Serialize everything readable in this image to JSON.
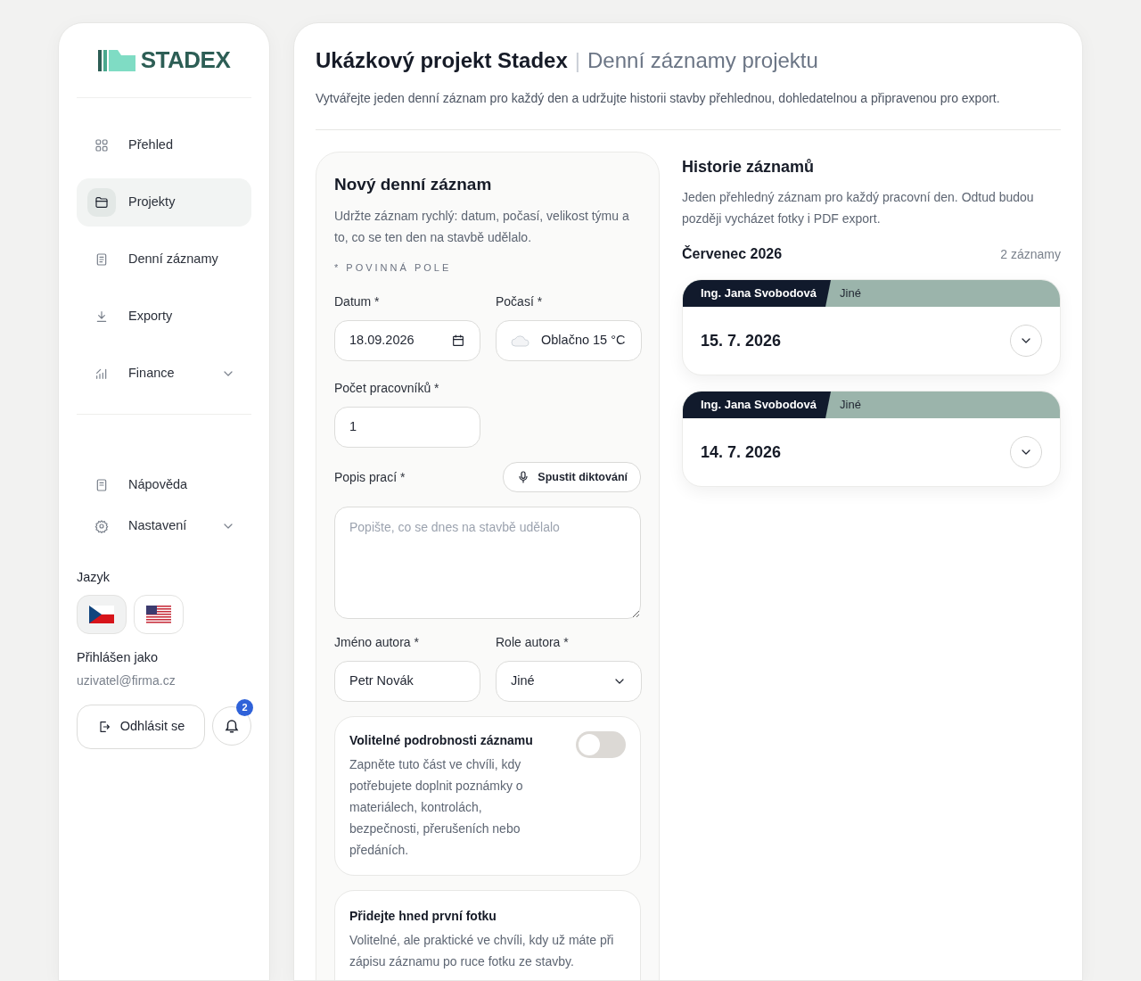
{
  "logo": {
    "text": "STADEX"
  },
  "nav": [
    {
      "label": "Přehled",
      "selected": false,
      "kind": "link"
    },
    {
      "label": "Projekty",
      "selected": true,
      "kind": "link"
    },
    {
      "label": "Denní záznamy",
      "selected": false,
      "kind": "link"
    },
    {
      "label": "Exporty",
      "selected": false,
      "kind": "link"
    },
    {
      "label": "Finance",
      "selected": false,
      "kind": "group"
    }
  ],
  "nav_bottom": [
    {
      "label": "Nápověda",
      "kind": "link"
    },
    {
      "label": "Nastavení",
      "kind": "group"
    }
  ],
  "language": {
    "label": "Jazyk",
    "options": [
      {
        "selected": true
      },
      {
        "selected": false
      }
    ]
  },
  "user": {
    "label": "Přihlášen jako",
    "email": "uzivatel@firma.cz"
  },
  "logout_button": "Odhlásit se",
  "notifications": {
    "count": "2"
  },
  "header": {
    "project": "Ukázkový projekt Stadex",
    "separator": "|",
    "page": "Denní záznamy projektu",
    "description": "Vytvářejte jeden denní záznam pro každý den a udržujte historii stavby přehlednou, dohledatelnou a připravenou pro export."
  },
  "form": {
    "title": "Nový denní záznam",
    "description": "Udržte záznam rychlý: datum, počasí, velikost týmu a to, co se ten den na stavbě udělalo.",
    "required_note": "* POVINNÁ POLE",
    "fields": [
      {
        "label": "Datum *",
        "value": "18.09.2026",
        "kind": "date"
      },
      {
        "label": "Počasí *",
        "value": "Oblačno 15 °C",
        "kind": "weather"
      },
      {
        "label": "Počet pracovníků *",
        "value": "1",
        "kind": "text"
      }
    ],
    "work": {
      "label": "Popis prací *",
      "button": "Spustit diktování",
      "placeholder": "Popište, co se dnes na stavbě udělalo"
    },
    "author_fields": [
      {
        "label": "Jméno autora *",
        "value": "Petr Novák",
        "kind": "text"
      },
      {
        "label": "Role autora *",
        "value": "Jiné",
        "kind": "select"
      }
    ],
    "optional": {
      "title": "Volitelné podrobnosti záznamu",
      "text": "Zapněte tuto část ve chvíli, kdy potřebujete doplnit poznámky o materiálech, kontrolách, bezpečnosti, přerušeních nebo předáních.",
      "on": false
    },
    "photo": {
      "title": "Přidejte hned první fotku",
      "text": "Volitelné, ale praktické ve chvíli, kdy už máte při zápisu záznamu po ruce fotku ze stavby."
    }
  },
  "history": {
    "title": "Historie záznamů",
    "description": "Jeden přehledný záznam pro každý pracovní den. Odtud budou později vycházet fotky i PDF export.",
    "month": "Červenec 2026",
    "count": "2 záznamy",
    "entries": [
      {
        "author": "Ing. Jana Svobodová",
        "role": "Jiné",
        "date": "15. 7. 2026",
        "expanded": false
      },
      {
        "author": "Ing. Jana Svobodová",
        "role": "Jiné",
        "date": "14. 7. 2026",
        "expanded": false
      }
    ]
  }
}
